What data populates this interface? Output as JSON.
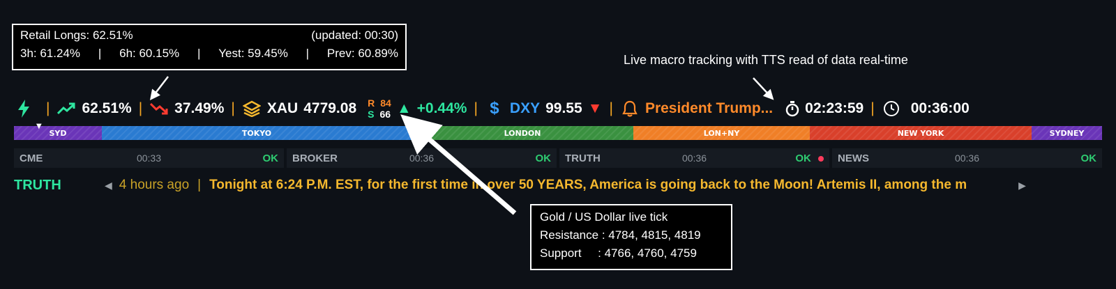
{
  "callouts": {
    "retail": {
      "title": "Retail Longs: 62.51%",
      "updated": "(updated: 00:30)",
      "h3": "3h: 61.24%",
      "h6": "6h: 60.15%",
      "yest": "Yest: 59.45%",
      "prev": "Prev: 60.89%",
      "divider": "|"
    },
    "macro_note": "Live macro tracking with TTS read of data real-time",
    "gold": {
      "line1": "Gold / US Dollar live tick",
      "line2": "Resistance : 4784, 4815, 4819",
      "line3": "Support     : 4766, 4760, 4759"
    }
  },
  "bar": {
    "long_pct": "62.51%",
    "short_pct": "37.49%",
    "symbol": "XAU",
    "price": "4779.08",
    "r_label": "R",
    "r_value": "84",
    "s_label": "S",
    "s_value": "66",
    "change": "+0.44%",
    "dxy_label": "DXY",
    "dxy_value": "99.55",
    "news_title": "President Trump...",
    "timer": "02:23:59",
    "clock": "00:36:00",
    "divider": "|"
  },
  "sessions": [
    {
      "label": "SYD",
      "color": "#6a35b8"
    },
    {
      "label": "TOKYO",
      "color": "#2a7bd1"
    },
    {
      "label": "LONDON",
      "color": "#3a9140"
    },
    {
      "label": "LON+NY",
      "color": "#f07f27"
    },
    {
      "label": "NEW YORK",
      "color": "#d9402b"
    },
    {
      "label": "SYDNEY",
      "color": "#6a35b8"
    }
  ],
  "feeds": [
    {
      "name": "CME",
      "time": "00:33",
      "status": "OK"
    },
    {
      "name": "BROKER",
      "time": "00:36",
      "status": "OK"
    },
    {
      "name": "TRUTH",
      "time": "00:36",
      "status": "OK"
    },
    {
      "name": "NEWS",
      "time": "00:36",
      "status": "OK"
    }
  ],
  "ticker": {
    "source": "TRUTH",
    "prev_icon": "◀",
    "age": "4 hours ago",
    "divider": "|",
    "message": "Tonight at 6:24 P.M. EST, for the first time in over 50 YEARS, America is going back to the Moon! Artemis II, among the m",
    "next_icon": "▶"
  },
  "colors": {
    "green": "#2ee6a0",
    "red": "#ff3b30",
    "orange": "#ff8a2a",
    "blue": "#3aa0ff",
    "gold": "#f5b82e",
    "separator": "#f5a623"
  },
  "icons": [
    "lightning-icon",
    "trend-up-icon",
    "trend-down-icon",
    "layers-icon",
    "triangle-up-icon",
    "dollar-icon",
    "triangle-down-icon",
    "bell-icon",
    "stopwatch-icon",
    "clock-icon",
    "session-marker-icon",
    "record-dot-icon"
  ]
}
